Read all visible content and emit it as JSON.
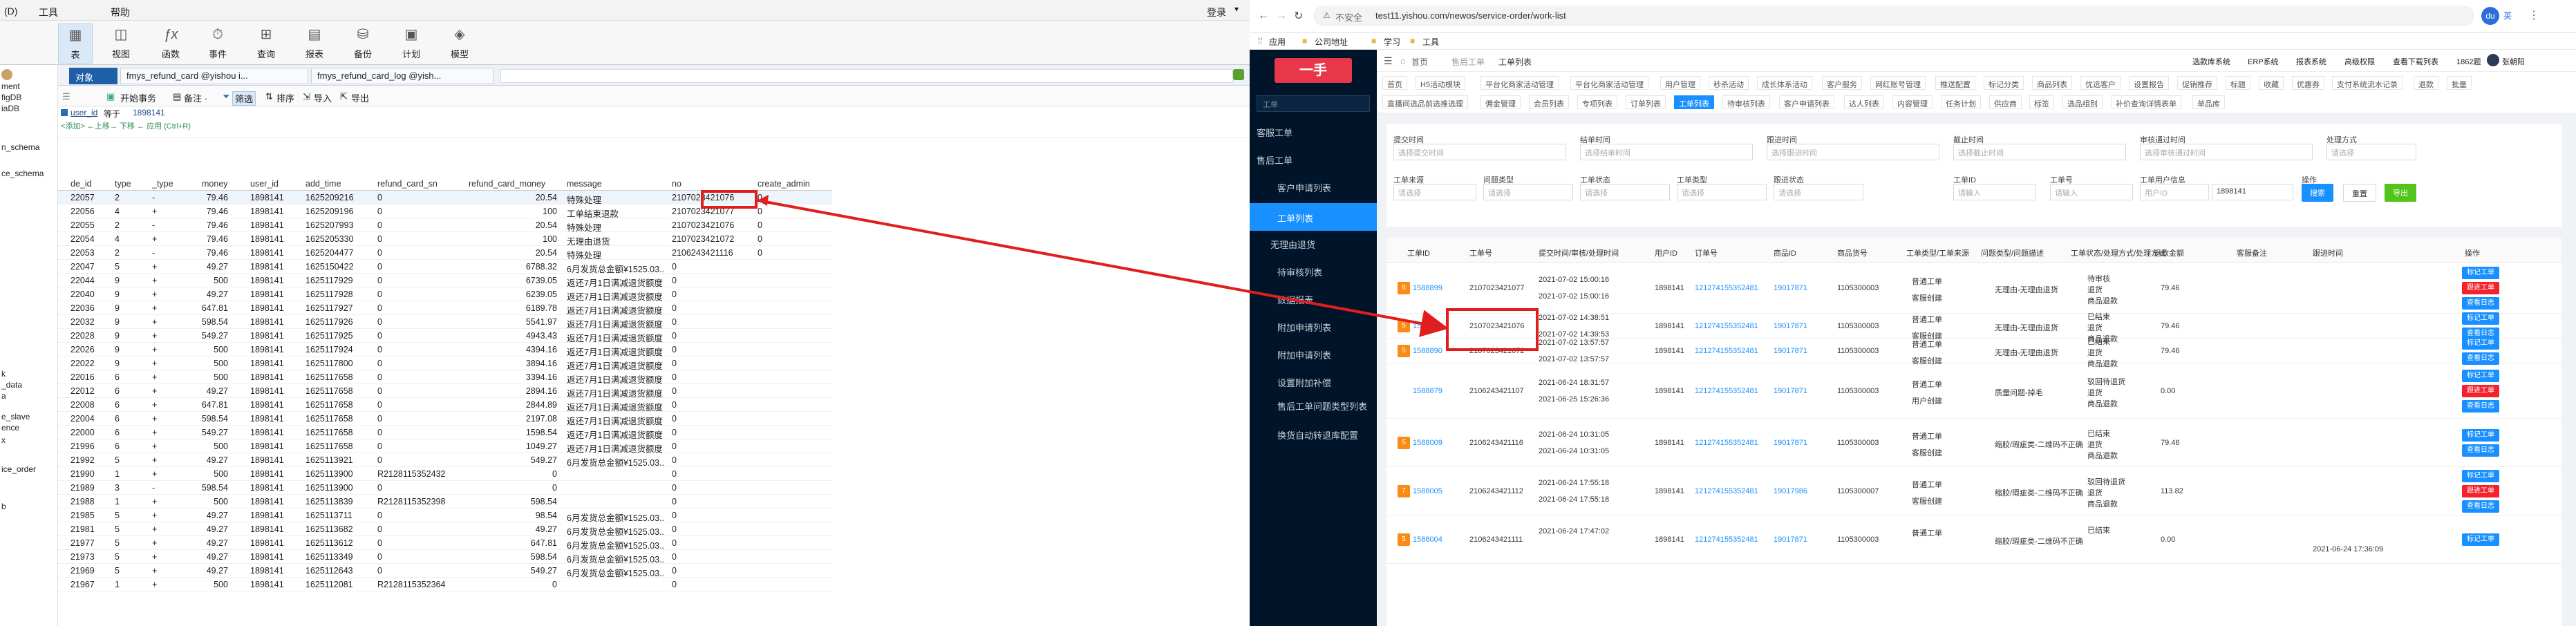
{
  "left": {
    "menubar": [
      "(D)",
      "工具",
      "帮助"
    ],
    "login_label": "登录",
    "toolbar": [
      {
        "label": "表",
        "icon": "table-icon"
      },
      {
        "label": "视图",
        "icon": "view-icon"
      },
      {
        "label": "函数",
        "icon": "function-icon"
      },
      {
        "label": "事件",
        "icon": "event-icon"
      },
      {
        "label": "查询",
        "icon": "query-icon"
      },
      {
        "label": "报表",
        "icon": "report-icon"
      },
      {
        "label": "备份",
        "icon": "backup-icon"
      },
      {
        "label": "计划",
        "icon": "schedule-icon"
      },
      {
        "label": "模型",
        "icon": "model-icon"
      }
    ],
    "sidebar": [
      "ment",
      "figDB",
      "iaDB",
      "n_schema",
      "ce_schema",
      "k",
      "_data",
      "a",
      "e_slave",
      "ence",
      "x",
      "ice_order",
      "b"
    ],
    "tabs": [
      "对象",
      "fmys_refund_card @yishou i...",
      "fmys_refund_card_log @yish..."
    ],
    "objtoolbar": [
      "开始事务",
      "备注 ·",
      "筛选",
      "排序",
      "导入",
      "导出"
    ],
    "filter": {
      "field": "user_id",
      "op": "等于",
      "value": "1898141",
      "hint": "<添加> ←上移→ 下移 ← 应用 (Ctrl+R)"
    },
    "headers": [
      "de_id",
      "type",
      "_type",
      "money",
      "user_id",
      "add_time",
      "refund_card_sn",
      "refund_card_money",
      "message",
      "no",
      "create_admin"
    ],
    "rows": [
      [
        "22057",
        "2",
        "-",
        "79.46",
        "1898141",
        "1625209216",
        "0",
        "20.54",
        "特殊处理",
        "2107023421076",
        "0"
      ],
      [
        "22056",
        "4",
        "+",
        "79.46",
        "1898141",
        "1625209196",
        "0",
        "100",
        "工单结束退款",
        "2107023421077",
        "0"
      ],
      [
        "22055",
        "2",
        "-",
        "79.46",
        "1898141",
        "1625207993",
        "0",
        "20.54",
        "特殊处理",
        "2107023421076",
        "0"
      ],
      [
        "22054",
        "4",
        "+",
        "79.46",
        "1898141",
        "1625205330",
        "0",
        "100",
        "无理由退货",
        "2107023421072",
        "0"
      ],
      [
        "22053",
        "2",
        "-",
        "79.46",
        "1898141",
        "1625204477",
        "0",
        "20.54",
        "特殊处理",
        "2106243421116",
        "0"
      ],
      [
        "22047",
        "5",
        "+",
        "49.27",
        "1898141",
        "1625150422",
        "0",
        "6788.32",
        "6月发货总金额¥1525.03...",
        "0",
        ""
      ],
      [
        "22044",
        "9",
        "+",
        "500",
        "1898141",
        "1625117929",
        "0",
        "6739.05",
        "返还7月1日满减退货额度",
        "0",
        ""
      ],
      [
        "22040",
        "9",
        "+",
        "49.27",
        "1898141",
        "1625117928",
        "0",
        "6239.05",
        "返还7月1日满减退货额度",
        "0",
        ""
      ],
      [
        "22036",
        "9",
        "+",
        "647.81",
        "1898141",
        "1625117927",
        "0",
        "6189.78",
        "返还7月1日满减退货额度",
        "0",
        ""
      ],
      [
        "22032",
        "9",
        "+",
        "598.54",
        "1898141",
        "1625117926",
        "0",
        "5541.97",
        "返还7月1日满减退货额度",
        "0",
        ""
      ],
      [
        "22028",
        "9",
        "+",
        "549.27",
        "1898141",
        "1625117925",
        "0",
        "4943.43",
        "返还7月1日满减退货额度",
        "0",
        ""
      ],
      [
        "22026",
        "9",
        "+",
        "500",
        "1898141",
        "1625117924",
        "0",
        "4394.16",
        "返还7月1日满减退货额度",
        "0",
        ""
      ],
      [
        "22022",
        "9",
        "+",
        "500",
        "1898141",
        "1625117800",
        "0",
        "3894.16",
        "返还7月1日满减退货额度",
        "0",
        ""
      ],
      [
        "22016",
        "6",
        "+",
        "500",
        "1898141",
        "1625117658",
        "0",
        "3394.16",
        "返还7月1日满减退货额度",
        "0",
        ""
      ],
      [
        "22012",
        "6",
        "+",
        "49.27",
        "1898141",
        "1625117658",
        "0",
        "2894.16",
        "返还7月1日满减退货额度",
        "0",
        ""
      ],
      [
        "22008",
        "6",
        "+",
        "647.81",
        "1898141",
        "1625117658",
        "0",
        "2844.89",
        "返还7月1日满减退货额度",
        "0",
        ""
      ],
      [
        "22004",
        "6",
        "+",
        "598.54",
        "1898141",
        "1625117658",
        "0",
        "2197.08",
        "返还7月1日满减退货额度",
        "0",
        ""
      ],
      [
        "22000",
        "6",
        "+",
        "549.27",
        "1898141",
        "1625117658",
        "0",
        "1598.54",
        "返还7月1日满减退货额度",
        "0",
        ""
      ],
      [
        "21996",
        "6",
        "+",
        "500",
        "1898141",
        "1625117658",
        "0",
        "1049.27",
        "返还7月1日满减退货额度",
        "0",
        ""
      ],
      [
        "21992",
        "5",
        "+",
        "49.27",
        "1898141",
        "1625113921",
        "0",
        "549.27",
        "6月发货总金额¥1525.03...",
        "0",
        ""
      ],
      [
        "21990",
        "1",
        "+",
        "500",
        "1898141",
        "1625113900",
        "R2128115352432",
        "0",
        "",
        "0",
        ""
      ],
      [
        "21989",
        "3",
        "-",
        "598.54",
        "1898141",
        "1625113900",
        "0",
        "0",
        "",
        "0",
        ""
      ],
      [
        "21988",
        "1",
        "+",
        "500",
        "1898141",
        "1625113839",
        "R2128115352398",
        "598.54",
        "",
        "0",
        ""
      ],
      [
        "21985",
        "5",
        "+",
        "49.27",
        "1898141",
        "1625113711",
        "0",
        "98.54",
        "6月发货总金额¥1525.03...",
        "0",
        ""
      ],
      [
        "21981",
        "5",
        "+",
        "49.27",
        "1898141",
        "1625113682",
        "0",
        "49.27",
        "6月发货总金额¥1525.03...",
        "0",
        ""
      ],
      [
        "21977",
        "5",
        "+",
        "49.27",
        "1898141",
        "1625113612",
        "0",
        "647.81",
        "6月发货总金额¥1525.03...",
        "0",
        ""
      ],
      [
        "21973",
        "5",
        "+",
        "49.27",
        "1898141",
        "1625113349",
        "0",
        "598.54",
        "6月发货总金额¥1525.03...",
        "0",
        ""
      ],
      [
        "21969",
        "5",
        "+",
        "49.27",
        "1898141",
        "1625112643",
        "0",
        "549.27",
        "6月发货总金额¥1525.03...",
        "0",
        ""
      ],
      [
        "21967",
        "1",
        "+",
        "500",
        "1898141",
        "1625112081",
        "R2128115352364",
        "0",
        "",
        "0",
        ""
      ]
    ]
  },
  "browser": {
    "insecure": "不安全",
    "url": "test11.yishou.com/newos/service-order/work-list",
    "bookmarks": [
      "应用",
      "公司地址",
      "学习",
      "工具"
    ],
    "ext_label": "英"
  },
  "app": {
    "logo": "一手",
    "search_placeholder": "工单",
    "nav": [
      {
        "label": "客服工单"
      },
      {
        "label": "售后工单"
      },
      {
        "label": "客户申请列表"
      },
      {
        "label": "工单列表",
        "active": true
      },
      {
        "label": "无理由退货"
      },
      {
        "label": "待审核列表"
      },
      {
        "label": "数据报表"
      },
      {
        "label": "附加申请列表"
      },
      {
        "label": "附加申请列表"
      },
      {
        "label": "设置附加补偿"
      },
      {
        "label": "售后工单问题类型列表"
      },
      {
        "label": "换货自动转退库配置"
      }
    ],
    "breadcrumb": [
      "首页",
      "售后工单",
      "工单列表"
    ],
    "header_links": [
      "选款库系统",
      "ERP系统",
      "报表系统",
      "高级权限",
      "查看下载列表",
      "1862题",
      "张朝阳"
    ],
    "tabs_row1": [
      "首页",
      "H5活动模块",
      "平台化商家活动管理",
      "平台化商家活动管理",
      "用户管理",
      "秒杀活动",
      "成长体系活动",
      "客户服务",
      "网红账号管理",
      "推送配置",
      "标记分类",
      "商品列表",
      "优选客户",
      "设置报告",
      "促销推荐",
      "标题",
      "收藏",
      "优惠券",
      "支付系统流水记录",
      "退款",
      "批量"
    ],
    "tabs_row2": [
      "直播间选品前选推选理",
      "佣金管理",
      "会员列表",
      "专项列表",
      "订单列表",
      "工单列表",
      "待审核列表",
      "客户申请列表",
      "达人列表",
      "内容管理",
      "任务计划",
      "供应商",
      "标签",
      "选品组别",
      "补价查询详情表单",
      "单品库"
    ],
    "active_tab": "工单列表",
    "filters": [
      {
        "label": "提交时间",
        "placeholder": "选择提交时间"
      },
      {
        "label": "结单时间",
        "placeholder": "选择结单时间"
      },
      {
        "label": "跟进时间",
        "placeholder": "选择跟进时间"
      },
      {
        "label": "截止时间",
        "placeholder": "选择截止时间"
      },
      {
        "label": "审核通过时间",
        "placeholder": "选择审核通过时间"
      },
      {
        "label": "处理方式",
        "placeholder": "请选择"
      },
      {
        "label": "工单来源",
        "placeholder": "请选择"
      },
      {
        "label": "问题类型",
        "placeholder": "请选择"
      },
      {
        "label": "工单状态",
        "placeholder": "请选择"
      },
      {
        "label": "工单类型",
        "placeholder": "请选择"
      },
      {
        "label": "跟进状态",
        "placeholder": "请选择"
      },
      {
        "label": "工单ID",
        "placeholder": "请输入"
      },
      {
        "label": "工单号",
        "placeholder": "请输入"
      },
      {
        "label": "工单用户信息",
        "placeholder": "用户ID",
        "value": "1898141"
      }
    ],
    "op_label": "操作",
    "buttons": [
      "搜索",
      "重置",
      "导出"
    ],
    "table_headers": [
      "工单ID",
      "工单号",
      "提交时间/审核/处理时间",
      "用户ID",
      "订单号",
      "商品ID",
      "商品货号",
      "工单类型/工单来源",
      "问题类型/问题描述",
      "工单状态/处理方式/处理方式",
      "退款金额",
      "客服备注",
      "跟进时间",
      "操作"
    ],
    "rows": [
      {
        "tag": "8",
        "id": "1588899",
        "no": "2107023421077",
        "times": [
          "2021-07-02 15:00:16",
          "2021-07-02 15:00:16"
        ],
        "uid": "1898141",
        "order": "121274155352481",
        "gid": "19017871",
        "sn": "1105300003",
        "type": [
          "普通工单",
          "客服创建"
        ],
        "issue": "无理由-无理由退货",
        "status": [
          "待审核",
          "退货",
          "商品退款"
        ],
        "refund": "79.46",
        "ops": [
          "标记工单",
          "跟进工单",
          "查看日志"
        ]
      },
      {
        "tag": "5",
        "id": "1588894",
        "no": "2107023421076",
        "times": [
          "2021-07-02 14:38:51",
          "2021-07-02 14:39:53"
        ],
        "uid": "1898141",
        "order": "121274155352481",
        "gid": "19017871",
        "sn": "1105300003",
        "type": [
          "普通工单",
          "客服创建"
        ],
        "issue": "无理由-无理由退货",
        "status": [
          "已结束",
          "退货",
          "商品退款"
        ],
        "refund": "79.46",
        "ops": [
          "标记工单",
          "查看日志"
        ]
      },
      {
        "tag": "5",
        "id": "1588890",
        "no": "2107023421072",
        "times": [
          "2021-07-02 13:57:57",
          "2021-07-02 13:57:57"
        ],
        "uid": "1898141",
        "order": "121274155352481",
        "gid": "19017871",
        "sn": "1105300003",
        "type": [
          "普通工单",
          "客服创建"
        ],
        "issue": "无理由-无理由退货",
        "status": [
          "已结束",
          "退货",
          "商品退款"
        ],
        "refund": "79.46",
        "ops": [
          "标记工单",
          "查看日志"
        ]
      },
      {
        "tag": "",
        "id": "1588879",
        "no": "2106243421107",
        "times": [
          "2021-06-24 18:31:57",
          "2021-06-25 15:26:36"
        ],
        "uid": "1898141",
        "order": "121274155352481",
        "gid": "19017871",
        "sn": "1105300003",
        "type": [
          "普通工单",
          "用户创建"
        ],
        "issue": "质量问题-掉毛",
        "status": [
          "驳回待退货",
          "退货",
          "商品退款"
        ],
        "refund": "0.00",
        "ops": [
          "标记工单",
          "跟进工单",
          "查看日志"
        ]
      },
      {
        "tag": "5",
        "id": "1588009",
        "no": "2106243421116",
        "times": [
          "2021-06-24 10:31:05",
          "2021-06-24 10:31:05"
        ],
        "uid": "1898141",
        "order": "121274155352481",
        "gid": "19017871",
        "sn": "1105300003",
        "type": [
          "普通工单",
          "客服创建"
        ],
        "issue": "缩胶/瑕疵类-二维码不正确",
        "status": [
          "已结束",
          "退货",
          "商品退款"
        ],
        "refund": "79.46",
        "ops": [
          "标记工单",
          "查看日志"
        ]
      },
      {
        "tag": "7",
        "id": "1588005",
        "no": "2106243421112",
        "times": [
          "2021-06-24 17:55:18",
          "2021-06-24 17:55:18"
        ],
        "uid": "1898141",
        "order": "121274155352481",
        "gid": "19017986",
        "sn": "1105300007",
        "type": [
          "普通工单",
          "客服创建"
        ],
        "issue": "缩胶/瑕疵类-二维码不正确",
        "status": [
          "驳回待退货",
          "退货",
          "商品退款"
        ],
        "refund": "113.82",
        "ops": [
          "标记工单",
          "跟进工单",
          "查看日志"
        ]
      },
      {
        "tag": "5",
        "id": "1588004",
        "no": "2106243421111",
        "times": [
          "2021-06-24 17:47:02",
          ""
        ],
        "uid": "1898141",
        "order": "121274155352481",
        "gid": "19017871",
        "sn": "1105300003",
        "type": [
          "普通工单",
          ""
        ],
        "issue": "缩胶/瑕疵类-二维码不正确",
        "status": [
          "已结束",
          "",
          ""
        ],
        "refund": "0.00",
        "follow": "2021-06-24 17:36:09",
        "ops": [
          "标记工单"
        ]
      }
    ]
  }
}
